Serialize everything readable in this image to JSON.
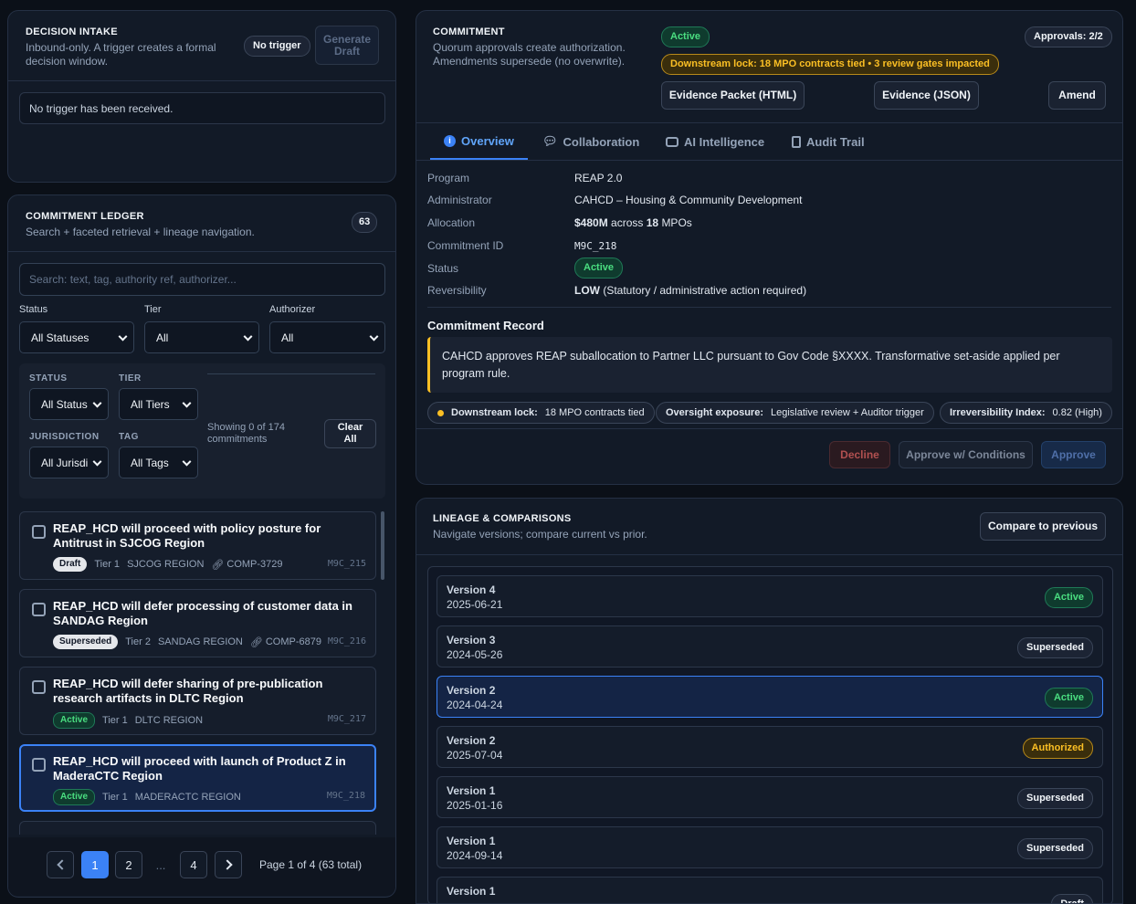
{
  "intake": {
    "title": "DECISION INTAKE",
    "subtitle": "Inbound-only. A trigger creates a formal decision window.",
    "trigger_badge": "No trigger",
    "generate_button": "Generate Draft",
    "empty_message": "No trigger has been received."
  },
  "ledger": {
    "title": "COMMITMENT LEDGER",
    "subtitle": "Search + faceted retrieval + lineage navigation.",
    "count": "63",
    "search_placeholder": "Search: text, tag, authority ref, authorizer...",
    "filters": {
      "status_label": "Status",
      "status_value": "All Statuses",
      "tier_label": "Tier",
      "tier_value": "All",
      "authorizer_label": "Authorizer",
      "authorizer_value": "All"
    },
    "facets": {
      "status_label": "STATUS",
      "status_value": "All Status",
      "tier_label": "TIER",
      "tier_value": "All Tiers",
      "jurisdiction_label": "JURISDICTION",
      "jurisdiction_value": "All Jurisdi",
      "tag_label": "TAG",
      "tag_value": "All Tags",
      "showing": "Showing 0 of 174 commitments",
      "clear_button": "Clear All"
    },
    "items": [
      {
        "title": "REAP_HCD will proceed with policy posture for Antitrust in SJCOG Region",
        "status": "Draft",
        "tier": "Tier 1",
        "region": "SJCOG REGION",
        "comp": "COMP-3729",
        "id": "M9C_215"
      },
      {
        "title": "REAP_HCD will defer processing of customer data in SANDAG Region",
        "status": "Superseded",
        "tier": "Tier 2",
        "region": "SANDAG REGION",
        "comp": "COMP-6879",
        "id": "M9C_216"
      },
      {
        "title": "REAP_HCD will defer sharing of pre-publication research artifacts in DLTC Region",
        "status": "Active",
        "tier": "Tier 1",
        "region": "DLTC REGION",
        "comp": "",
        "id": "M9C_217"
      },
      {
        "title": "REAP_HCD will proceed with launch of Product Z in MaderaCTC Region",
        "status": "Active",
        "tier": "Tier 1",
        "region": "MADERACTC REGION",
        "comp": "",
        "id": "M9C_218"
      }
    ],
    "pagination": {
      "pages": [
        "1",
        "2",
        "...",
        "4"
      ],
      "info": "Page 1 of 4 (63 total)"
    }
  },
  "commitment": {
    "title": "COMMITMENT",
    "subtitle": "Quorum approvals create authorization. Amendments supersede (no overwrite).",
    "status_badge": "Active",
    "approvals": "Approvals: 2/2",
    "lock_banner": "Downstream lock: 18 MPO contracts tied • 3 review gates impacted",
    "buttons": {
      "evidence_html": "Evidence Packet (HTML)",
      "evidence_json": "Evidence (JSON)",
      "amend": "Amend"
    },
    "tabs": [
      "Overview",
      "Collaboration",
      "AI Intelligence",
      "Audit Trail"
    ],
    "overview": {
      "program_label": "Program",
      "program": "REAP 2.0",
      "admin_label": "Administrator",
      "admin": "CAHCD – Housing & Community Development",
      "alloc_label": "Allocation",
      "alloc_amount": "$480M",
      "alloc_across": "across",
      "alloc_count": "18",
      "alloc_unit": "MPOs",
      "cid_label": "Commitment ID",
      "cid": "M9C_218",
      "status_label": "Status",
      "status": "Active",
      "rev_label": "Reversibility",
      "rev_level": "LOW",
      "rev_note": "(Statutory / administrative action required)"
    },
    "record_title": "Commitment Record",
    "record_text": "CAHCD approves REAP suballocation to Partner LLC pursuant to Gov Code §XXXX. Transformative set-aside applied per program rule.",
    "chips": [
      {
        "label": "Downstream lock:",
        "value": "18 MPO contracts tied"
      },
      {
        "label": "Oversight exposure:",
        "value": "Legislative review + Auditor trigger"
      },
      {
        "label": "Irreversibility Index:",
        "value": "0.82 (High)"
      }
    ],
    "actions": {
      "decline": "Decline",
      "approve_conditions": "Approve w/ Conditions",
      "approve": "Approve"
    },
    "colors": {
      "accent": "#3b82f6",
      "active": "#4ade80",
      "warning": "#fbbf24",
      "danger": "#f87171"
    }
  },
  "lineage": {
    "title": "LINEAGE & COMPARISONS",
    "subtitle": "Navigate versions; compare current vs prior.",
    "compare_button": "Compare to previous",
    "versions": [
      {
        "label": "Version 4",
        "date": "2025-06-21",
        "status": "Active"
      },
      {
        "label": "Version 3",
        "date": "2024-05-26",
        "status": "Superseded"
      },
      {
        "label": "Version 2",
        "date": "2024-04-24",
        "status": "Active"
      },
      {
        "label": "Version 2",
        "date": "2025-07-04",
        "status": "Authorized"
      },
      {
        "label": "Version 1",
        "date": "2025-01-16",
        "status": "Superseded"
      },
      {
        "label": "Version 1",
        "date": "2024-09-14",
        "status": "Superseded"
      },
      {
        "label": "Version 1",
        "date": "",
        "status": "Draft"
      }
    ]
  }
}
